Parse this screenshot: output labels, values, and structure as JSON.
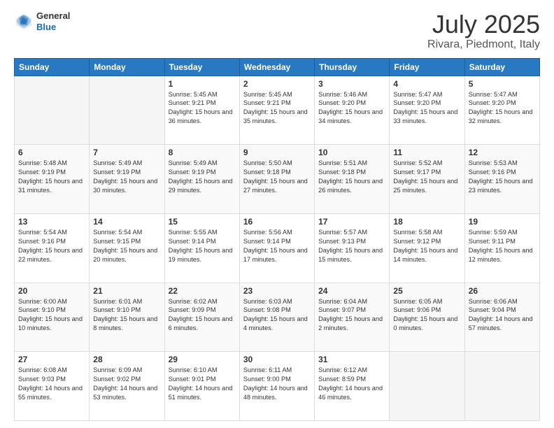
{
  "header": {
    "logo": {
      "line1": "General",
      "line2": "Blue"
    },
    "title": "July 2025",
    "subtitle": "Rivara, Piedmont, Italy"
  },
  "calendar": {
    "weekdays": [
      "Sunday",
      "Monday",
      "Tuesday",
      "Wednesday",
      "Thursday",
      "Friday",
      "Saturday"
    ],
    "weeks": [
      [
        {
          "day": "",
          "info": ""
        },
        {
          "day": "",
          "info": ""
        },
        {
          "day": "1",
          "info": "Sunrise: 5:45 AM\nSunset: 9:21 PM\nDaylight: 15 hours and 36 minutes."
        },
        {
          "day": "2",
          "info": "Sunrise: 5:45 AM\nSunset: 9:21 PM\nDaylight: 15 hours and 35 minutes."
        },
        {
          "day": "3",
          "info": "Sunrise: 5:46 AM\nSunset: 9:20 PM\nDaylight: 15 hours and 34 minutes."
        },
        {
          "day": "4",
          "info": "Sunrise: 5:47 AM\nSunset: 9:20 PM\nDaylight: 15 hours and 33 minutes."
        },
        {
          "day": "5",
          "info": "Sunrise: 5:47 AM\nSunset: 9:20 PM\nDaylight: 15 hours and 32 minutes."
        }
      ],
      [
        {
          "day": "6",
          "info": "Sunrise: 5:48 AM\nSunset: 9:19 PM\nDaylight: 15 hours and 31 minutes."
        },
        {
          "day": "7",
          "info": "Sunrise: 5:49 AM\nSunset: 9:19 PM\nDaylight: 15 hours and 30 minutes."
        },
        {
          "day": "8",
          "info": "Sunrise: 5:49 AM\nSunset: 9:19 PM\nDaylight: 15 hours and 29 minutes."
        },
        {
          "day": "9",
          "info": "Sunrise: 5:50 AM\nSunset: 9:18 PM\nDaylight: 15 hours and 27 minutes."
        },
        {
          "day": "10",
          "info": "Sunrise: 5:51 AM\nSunset: 9:18 PM\nDaylight: 15 hours and 26 minutes."
        },
        {
          "day": "11",
          "info": "Sunrise: 5:52 AM\nSunset: 9:17 PM\nDaylight: 15 hours and 25 minutes."
        },
        {
          "day": "12",
          "info": "Sunrise: 5:53 AM\nSunset: 9:16 PM\nDaylight: 15 hours and 23 minutes."
        }
      ],
      [
        {
          "day": "13",
          "info": "Sunrise: 5:54 AM\nSunset: 9:16 PM\nDaylight: 15 hours and 22 minutes."
        },
        {
          "day": "14",
          "info": "Sunrise: 5:54 AM\nSunset: 9:15 PM\nDaylight: 15 hours and 20 minutes."
        },
        {
          "day": "15",
          "info": "Sunrise: 5:55 AM\nSunset: 9:14 PM\nDaylight: 15 hours and 19 minutes."
        },
        {
          "day": "16",
          "info": "Sunrise: 5:56 AM\nSunset: 9:14 PM\nDaylight: 15 hours and 17 minutes."
        },
        {
          "day": "17",
          "info": "Sunrise: 5:57 AM\nSunset: 9:13 PM\nDaylight: 15 hours and 15 minutes."
        },
        {
          "day": "18",
          "info": "Sunrise: 5:58 AM\nSunset: 9:12 PM\nDaylight: 15 hours and 14 minutes."
        },
        {
          "day": "19",
          "info": "Sunrise: 5:59 AM\nSunset: 9:11 PM\nDaylight: 15 hours and 12 minutes."
        }
      ],
      [
        {
          "day": "20",
          "info": "Sunrise: 6:00 AM\nSunset: 9:10 PM\nDaylight: 15 hours and 10 minutes."
        },
        {
          "day": "21",
          "info": "Sunrise: 6:01 AM\nSunset: 9:10 PM\nDaylight: 15 hours and 8 minutes."
        },
        {
          "day": "22",
          "info": "Sunrise: 6:02 AM\nSunset: 9:09 PM\nDaylight: 15 hours and 6 minutes."
        },
        {
          "day": "23",
          "info": "Sunrise: 6:03 AM\nSunset: 9:08 PM\nDaylight: 15 hours and 4 minutes."
        },
        {
          "day": "24",
          "info": "Sunrise: 6:04 AM\nSunset: 9:07 PM\nDaylight: 15 hours and 2 minutes."
        },
        {
          "day": "25",
          "info": "Sunrise: 6:05 AM\nSunset: 9:06 PM\nDaylight: 15 hours and 0 minutes."
        },
        {
          "day": "26",
          "info": "Sunrise: 6:06 AM\nSunset: 9:04 PM\nDaylight: 14 hours and 57 minutes."
        }
      ],
      [
        {
          "day": "27",
          "info": "Sunrise: 6:08 AM\nSunset: 9:03 PM\nDaylight: 14 hours and 55 minutes."
        },
        {
          "day": "28",
          "info": "Sunrise: 6:09 AM\nSunset: 9:02 PM\nDaylight: 14 hours and 53 minutes."
        },
        {
          "day": "29",
          "info": "Sunrise: 6:10 AM\nSunset: 9:01 PM\nDaylight: 14 hours and 51 minutes."
        },
        {
          "day": "30",
          "info": "Sunrise: 6:11 AM\nSunset: 9:00 PM\nDaylight: 14 hours and 48 minutes."
        },
        {
          "day": "31",
          "info": "Sunrise: 6:12 AM\nSunset: 8:59 PM\nDaylight: 14 hours and 46 minutes."
        },
        {
          "day": "",
          "info": ""
        },
        {
          "day": "",
          "info": ""
        }
      ]
    ]
  }
}
